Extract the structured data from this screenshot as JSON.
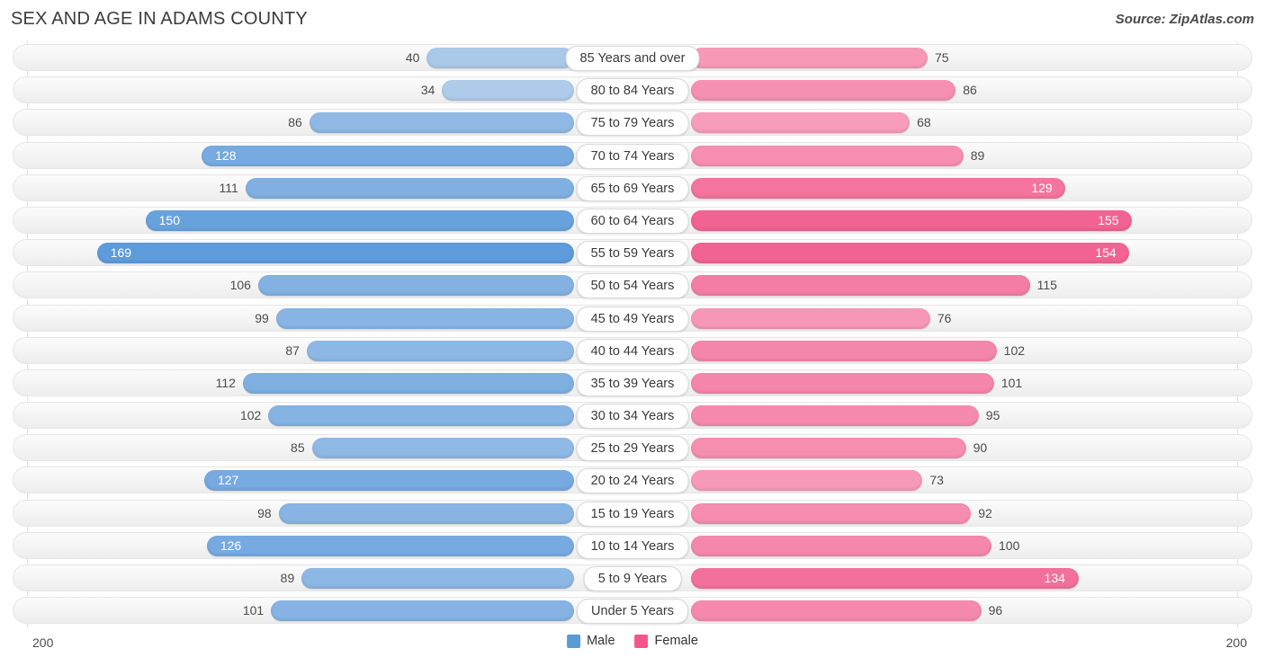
{
  "header": {
    "title": "SEX AND AGE IN ADAMS COUNTY",
    "source": "Source: ZipAtlas.com"
  },
  "footer": {
    "axis_min_left": "200",
    "axis_min_right": "200",
    "legend": [
      {
        "label": "Male",
        "color": "#5b9bd5"
      },
      {
        "label": "Female",
        "color": "#f4558c"
      }
    ]
  },
  "colors": {
    "male_min": "#aecbea",
    "male_max": "#5d9bdb",
    "female_min": "#f9b3ca",
    "female_max": "#f1598c",
    "track": "#f4f4f4",
    "text": "#4c4c4c"
  },
  "chart_data": {
    "type": "bar",
    "subtype": "population-pyramid",
    "title": "SEX AND AGE IN ADAMS COUNTY",
    "xlabel": "",
    "ylabel": "",
    "xlim": [
      200,
      200
    ],
    "axis_max": 200,
    "grid": false,
    "legend_position": "bottom-center",
    "categories": [
      "85 Years and over",
      "80 to 84 Years",
      "75 to 79 Years",
      "70 to 74 Years",
      "65 to 69 Years",
      "60 to 64 Years",
      "55 to 59 Years",
      "50 to 54 Years",
      "45 to 49 Years",
      "40 to 44 Years",
      "35 to 39 Years",
      "30 to 34 Years",
      "25 to 29 Years",
      "20 to 24 Years",
      "15 to 19 Years",
      "10 to 14 Years",
      "5 to 9 Years",
      "Under 5 Years"
    ],
    "series": [
      {
        "name": "Male",
        "color": "#5b9bd5",
        "values": [
          40,
          34,
          86,
          128,
          111,
          150,
          169,
          106,
          99,
          87,
          112,
          102,
          85,
          127,
          98,
          126,
          89,
          101
        ]
      },
      {
        "name": "Female",
        "color": "#f4558c",
        "values": [
          75,
          86,
          68,
          89,
          129,
          155,
          154,
          115,
          76,
          102,
          101,
          95,
          90,
          73,
          92,
          100,
          134,
          96
        ]
      }
    ]
  }
}
